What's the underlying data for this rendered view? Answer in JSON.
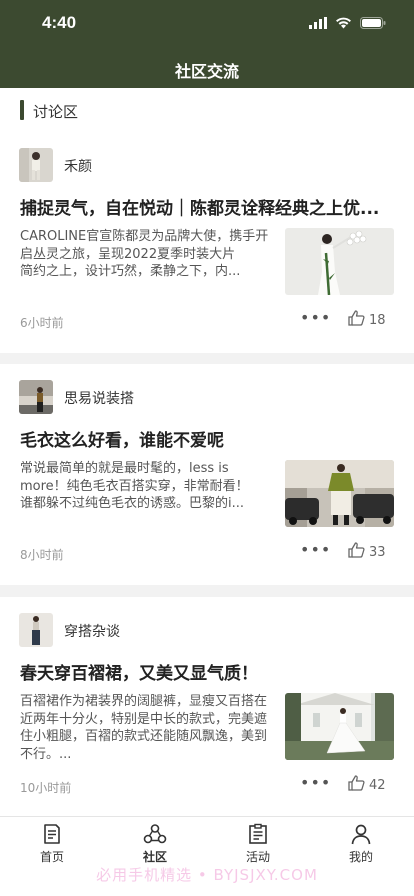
{
  "status_bar": {
    "time": "4:40"
  },
  "header": {
    "title": "社区交流"
  },
  "section": {
    "title": "讨论区"
  },
  "posts": [
    {
      "author": "禾颜",
      "title": "捕捉灵气，自在悦动｜陈都灵诠释经典之上优...",
      "excerpt_lines": [
        "CAROLINE官宣陈都灵为品牌大使，携手开启丛灵之旅，呈现2022夏季时装大片",
        "简约之上，设计巧然，柔静之下，内..."
      ],
      "time": "6小时前",
      "likes": "18"
    },
    {
      "author": "思易说装搭",
      "title": "毛衣这么好看，谁能不爱呢",
      "excerpt_lines": [
        "常说最简单的就是最时髦的，less is more！纯色毛衣百搭实穿，非常耐看！",
        "谁都躲不过纯色毛衣的诱惑。巴黎的i..."
      ],
      "time": "8小时前",
      "likes": "33"
    },
    {
      "author": "穿搭杂谈",
      "title": "春天穿百褶裙，又美又显气质！",
      "excerpt_lines": [
        "百褶裙作为裙装界的阔腿裤，显瘦又百搭在近两年十分火，特别是中长的款式，完美遮住小粗腿，百褶的款式还能随风飘逸，美到不行。..."
      ],
      "time": "10小时前",
      "likes": "42"
    }
  ],
  "more_glyph": "•••",
  "tabs": [
    {
      "label": "首页",
      "icon": "document-icon"
    },
    {
      "label": "社区",
      "icon": "community-icon",
      "active": true
    },
    {
      "label": "活动",
      "icon": "clipboard-icon"
    },
    {
      "label": "我的",
      "icon": "person-icon"
    }
  ],
  "watermark": "必用手机精选 • BYJSJXY.COM",
  "colors": {
    "header_bg": "#3c4a30",
    "accent": "#3c4a30"
  }
}
